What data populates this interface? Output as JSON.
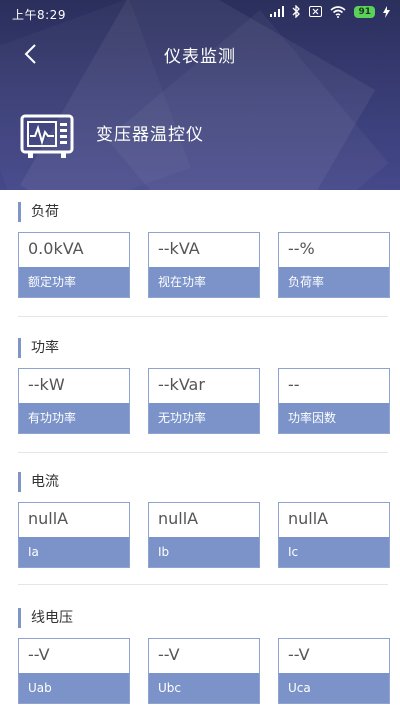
{
  "status_bar": {
    "time": "上午8:29",
    "battery": "91",
    "icons": [
      "signal-icon",
      "bluetooth-icon",
      "sim-off-icon",
      "wifi-icon",
      "battery-icon"
    ]
  },
  "navbar": {
    "title": "仪表监测"
  },
  "device": {
    "name": "变压器温控仪",
    "icon": "meter-monitor-icon"
  },
  "sections": [
    {
      "title": "负荷",
      "cards": [
        {
          "value": "0.0kVA",
          "label": "额定功率"
        },
        {
          "value": "--kVA",
          "label": "视在功率"
        },
        {
          "value": "--%",
          "label": "负荷率"
        }
      ]
    },
    {
      "title": "功率",
      "cards": [
        {
          "value": "--kW",
          "label": "有功功率"
        },
        {
          "value": "--kVar",
          "label": "无功功率"
        },
        {
          "value": "--",
          "label": "功率因数"
        }
      ]
    },
    {
      "title": "电流",
      "cards": [
        {
          "value": "nullA",
          "label": "Ia"
        },
        {
          "value": "nullA",
          "label": "Ib"
        },
        {
          "value": "nullA",
          "label": "Ic"
        }
      ]
    },
    {
      "title": "线电压",
      "cards": [
        {
          "value": "--V",
          "label": "Uab"
        },
        {
          "value": "--V",
          "label": "Ubc"
        },
        {
          "value": "--V",
          "label": "Uca"
        }
      ]
    }
  ],
  "colors": {
    "header_dark": "#2b2f5c",
    "header_light": "#45488a",
    "card_border": "#8fa3d0",
    "card_label_bg": "#7b93c9",
    "section_accent": "#7f95c8"
  }
}
